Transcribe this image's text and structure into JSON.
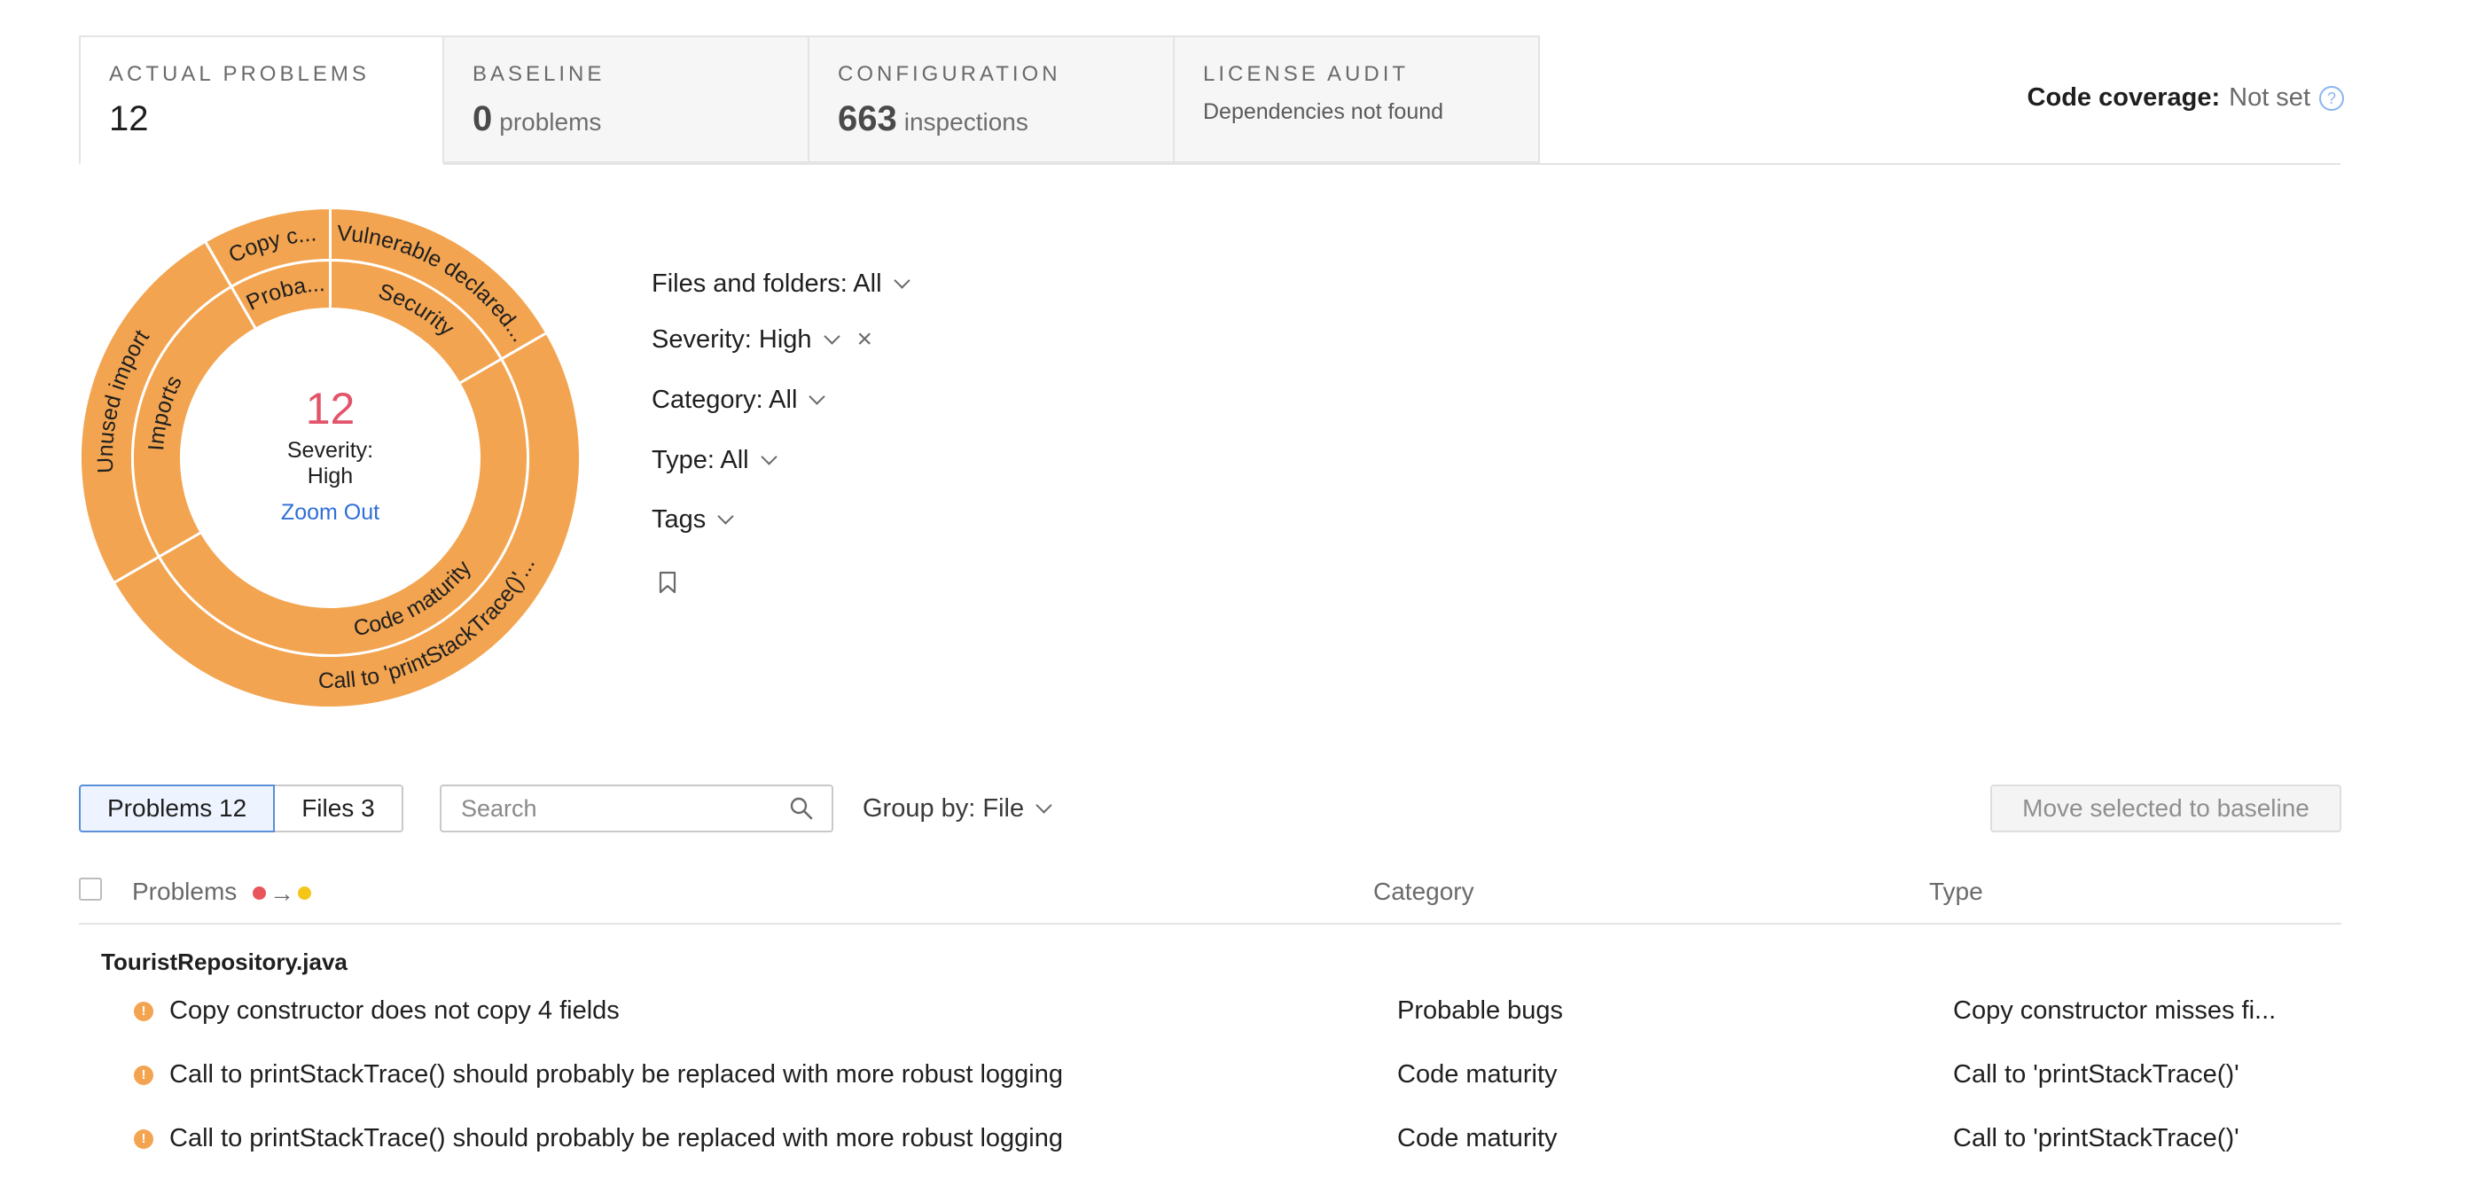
{
  "tabs": [
    {
      "label": "ACTUAL PROBLEMS",
      "num": "12",
      "unit": ""
    },
    {
      "label": "BASELINE",
      "num": "0",
      "unit": "problems"
    },
    {
      "label": "CONFIGURATION",
      "num": "663",
      "unit": "inspections"
    },
    {
      "label": "LICENSE AUDIT",
      "sub": "Dependencies not found"
    }
  ],
  "coverage": {
    "label": "Code coverage:",
    "value": "Not set",
    "icon": "help-circle-icon"
  },
  "sunburst": {
    "center_count": "12",
    "center_severity": "Severity: High",
    "zoom_out": "Zoom Out",
    "color": "#f3a450",
    "inner": [
      {
        "label": "Security",
        "value": 2
      },
      {
        "label": "Code maturity",
        "value": 6
      },
      {
        "label": "Imports",
        "value": 3
      },
      {
        "label": "Proba...",
        "value": 1
      }
    ],
    "outer": [
      {
        "label": "Vulnerable declared...",
        "value": 2
      },
      {
        "label": "Call to 'printStackTrace()'...",
        "value": 6
      },
      {
        "label": "Unused import",
        "value": 3
      },
      {
        "label": "Copy c...",
        "value": 1
      }
    ]
  },
  "filters": {
    "files": "Files and folders: All",
    "severity": "Severity: High",
    "category": "Category: All",
    "type": "Type: All",
    "tags": "Tags"
  },
  "toolbar": {
    "problems_btn": "Problems 12",
    "files_btn": "Files 3",
    "search_placeholder": "Search",
    "group_by": "Group by: File",
    "move_btn": "Move selected to baseline"
  },
  "table": {
    "headers": {
      "problems": "Problems",
      "category": "Category",
      "type": "Type"
    },
    "severity_colors": {
      "from": "#e8545a",
      "to": "#f5c518"
    },
    "group": "TouristRepository.java",
    "rows": [
      {
        "problem": "Copy constructor does not copy 4 fields",
        "category": "Probable bugs",
        "type": "Copy constructor misses fi..."
      },
      {
        "problem": "Call to printStackTrace() should probably be replaced with more robust logging",
        "category": "Code maturity",
        "type": "Call to 'printStackTrace()'"
      },
      {
        "problem": "Call to printStackTrace() should probably be replaced with more robust logging",
        "category": "Code maturity",
        "type": "Call to 'printStackTrace()'"
      }
    ]
  }
}
